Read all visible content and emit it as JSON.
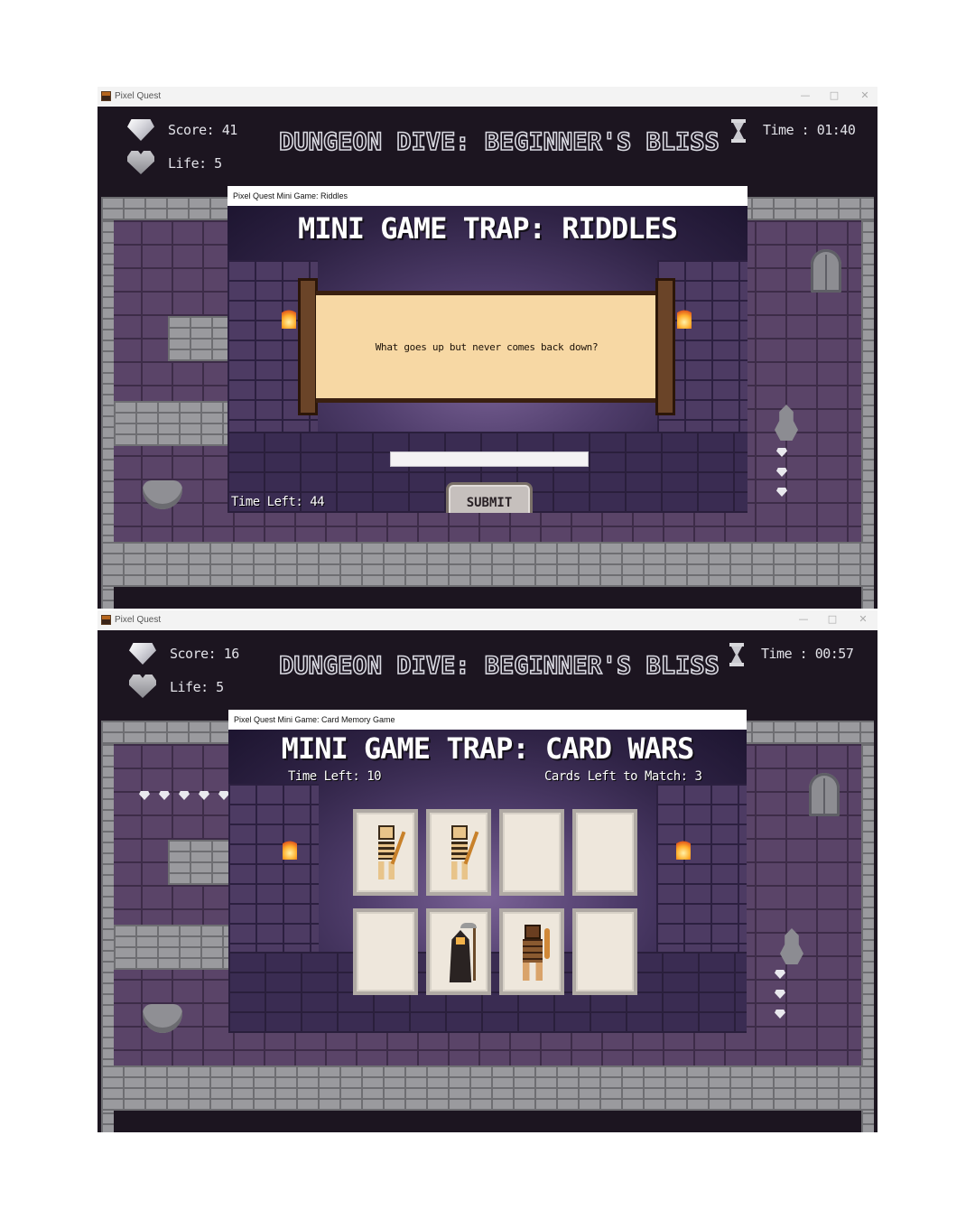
{
  "windows": [
    {
      "app_title": "Pixel Quest",
      "window_controls": {
        "minimize": "—",
        "maximize": "□",
        "close": "✕"
      },
      "hud": {
        "score": "Score: 41",
        "life": "Life: 5",
        "time": "Time : 01:40",
        "level_title": "DUNGEON DIVE: BEGINNER'S BLISS"
      },
      "dialog": {
        "window_title": "Pixel Quest Mini Game: Riddles",
        "title": "MINI GAME TRAP: RIDDLES",
        "question": "What goes up but never comes back down?",
        "answer_value": "",
        "submit_label": "SUBMIT",
        "time_left": "Time Left: 44"
      }
    },
    {
      "app_title": "Pixel Quest",
      "window_controls": {
        "minimize": "—",
        "maximize": "□",
        "close": "✕"
      },
      "hud": {
        "score": "Score: 16",
        "life": "Life: 5",
        "time": "Time : 00:57",
        "level_title": "DUNGEON DIVE: BEGINNER'S BLISS"
      },
      "dialog": {
        "window_title": "Pixel Quest Mini Game: Card Memory Game",
        "title": "MINI GAME TRAP: CARD WARS",
        "time_left": "Time Left: 10",
        "cards_left": "Cards Left to Match: 3",
        "cards": [
          {
            "face": "skeleton",
            "revealed": true
          },
          {
            "face": "skeleton",
            "revealed": true
          },
          {
            "face": "",
            "revealed": false
          },
          {
            "face": "",
            "revealed": false
          },
          {
            "face": "",
            "revealed": false
          },
          {
            "face": "reaper",
            "revealed": true
          },
          {
            "face": "warrior",
            "revealed": true
          },
          {
            "face": "",
            "revealed": false
          }
        ]
      }
    }
  ],
  "icons": {
    "score": "gem-icon",
    "life": "heart-icon",
    "timer": "hourglass-icon"
  },
  "colors": {
    "background": "#1c1520",
    "wall": "#5a4468",
    "stone": "#9a9a9e",
    "scroll": "#f7d8a4",
    "text": "#ffffff"
  }
}
